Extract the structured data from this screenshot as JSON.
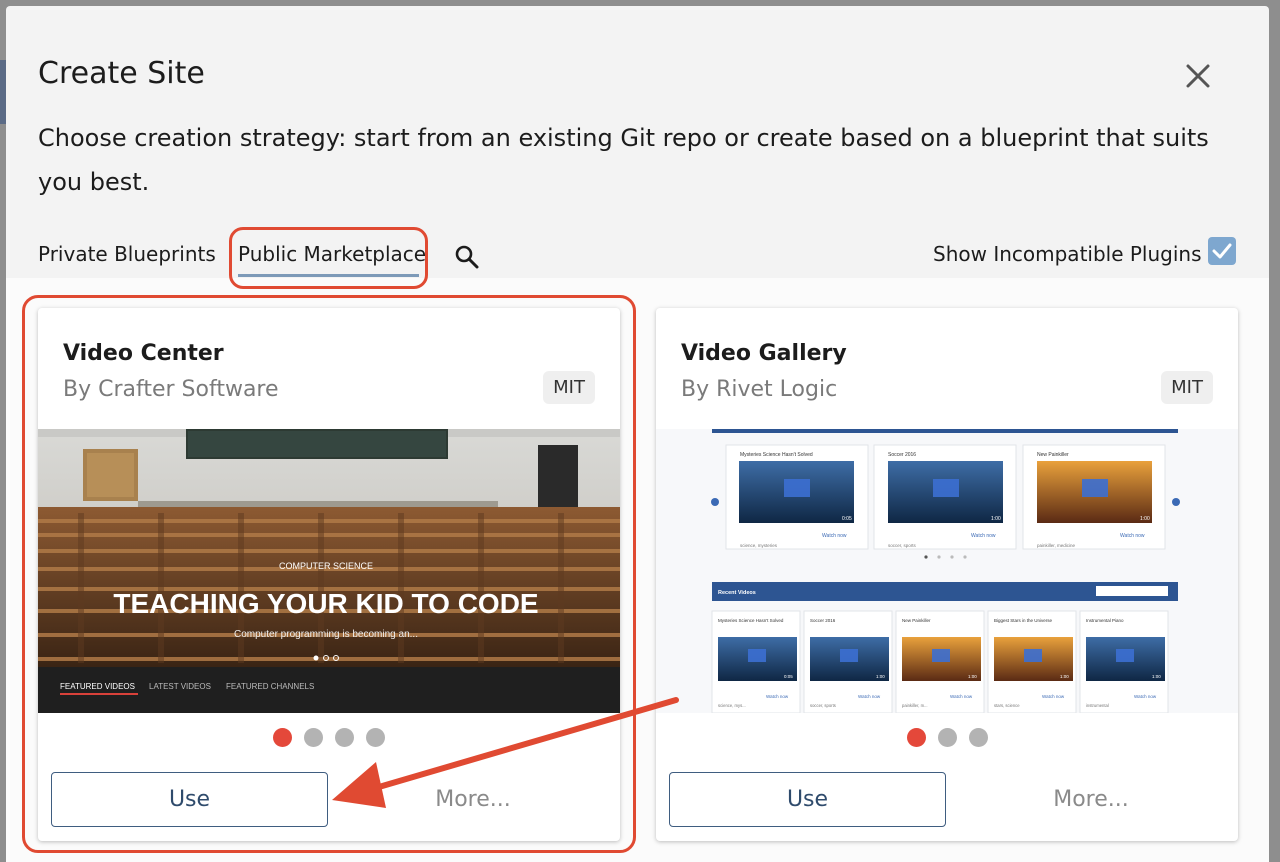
{
  "dialog": {
    "title": "Create Site",
    "subtitle": "Choose creation strategy: start from an existing Git repo or create based on a blueprint that suits you best.",
    "close_icon": "close-icon"
  },
  "tabs": [
    {
      "label": "Private Blueprints",
      "selected": false
    },
    {
      "label": "Public Marketplace",
      "selected": true
    }
  ],
  "toolbar": {
    "search_icon": "search-icon",
    "show_incompatible_label": "Show Incompatible Plugins",
    "show_incompatible_checked": true
  },
  "cards": [
    {
      "title": "Video Center",
      "author": "By Crafter Software",
      "license": "MIT",
      "preview": {
        "category": "COMPUTER SCIENCE",
        "headline": "TEACHING YOUR KID TO CODE",
        "teaser": "Computer programming is becoming an...",
        "nav": [
          "FEATURED VIDEOS",
          "LATEST VIDEOS",
          "FEATURED CHANNELS"
        ]
      },
      "dots": 4,
      "active_dot": 0,
      "use_label": "Use",
      "more_label": "More..."
    },
    {
      "title": "Video Gallery",
      "author": "By Rivet Logic",
      "license": "MIT",
      "preview": {
        "featured": [
          {
            "title": "Mysteries Science Hasn't Solved",
            "duration": "0:05",
            "tags": "science, mysteries",
            "link": "Watch now"
          },
          {
            "title": "Soccer 2016",
            "duration": "1:00",
            "tags": "soccer, sports",
            "link": "Watch now"
          },
          {
            "title": "New Painkiller",
            "duration": "1:00",
            "tags": "painkiller, medicine",
            "link": "Watch now"
          }
        ],
        "recent_header": "Recent Videos",
        "recent": [
          {
            "title": "Mysteries Science Hasn't Solved",
            "duration": "0:05",
            "tags": "science, mys...",
            "link": "Watch now"
          },
          {
            "title": "Soccer 2016",
            "duration": "1:00",
            "tags": "soccer, sports",
            "link": "Watch now"
          },
          {
            "title": "New Painkiller",
            "duration": "1:00",
            "tags": "painkiller, m...",
            "link": "Watch now"
          },
          {
            "title": "Biggest Stars in the Universe",
            "duration": "1:00",
            "tags": "stars, science",
            "link": "Watch now"
          },
          {
            "title": "Instrumental Piano",
            "duration": "1:00",
            "tags": "instrumental",
            "link": "Watch now"
          }
        ]
      },
      "dots": 3,
      "active_dot": 0,
      "use_label": "Use",
      "more_label": "More..."
    }
  ],
  "annotation": {
    "highlight_color": "#e04a32"
  }
}
